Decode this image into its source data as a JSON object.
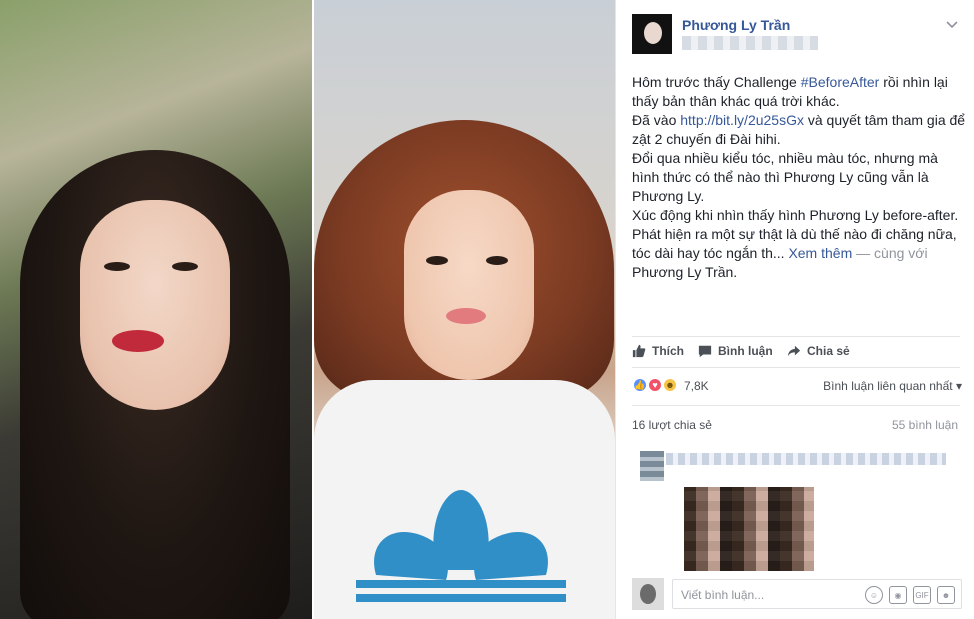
{
  "post": {
    "author": "Phương Ly Trần",
    "body": {
      "line1_pre": "Hôm trước thấy Challenge ",
      "hashtag": "#BeforeAfter",
      "line1_post": " rồi nhìn lại thấy bản thân khác quá trời khác.",
      "line2_pre": "Đã vào ",
      "url": "http://bit.ly/2u25sGx",
      "line2_post": " và quyết tâm tham gia để zật 2 chuyến đi Đài hihi.",
      "line3": "Đổi qua nhiều kiểu tóc, nhiều màu tóc, nhưng mà hình thức có thể nào thì Phương Ly cũng vẫn là Phương Ly.",
      "line4": "Xúc động khi nhìn thấy hình Phương Ly before-after. Phát hiện ra một sự thật là dù thế nào đi chăng nữa, tóc dài hay tóc ngắn th...",
      "see_more": "Xem thêm",
      "with": " — cùng với ",
      "tagged": "Phương Ly Trần."
    }
  },
  "actions": {
    "like": "Thích",
    "comment": "Bình luận",
    "share": "Chia sẻ"
  },
  "stats": {
    "reactions_count": "7,8K",
    "sort_label": "Bình luận liên quan nhất",
    "shares": "16 lượt chia sẻ",
    "comments": "55 bình luận"
  },
  "composer": {
    "placeholder": "Viết bình luận...",
    "gif_label": "GIF"
  },
  "colors": {
    "link": "#365899",
    "like_blue": "#5890ff",
    "love_red": "#f25268",
    "haha_yellow": "#f7c44a"
  },
  "icons": [
    "like-icon",
    "comment-icon",
    "share-icon",
    "emoji-icon",
    "camera-icon",
    "gif-icon",
    "sticker-icon",
    "chevron-down-icon"
  ]
}
